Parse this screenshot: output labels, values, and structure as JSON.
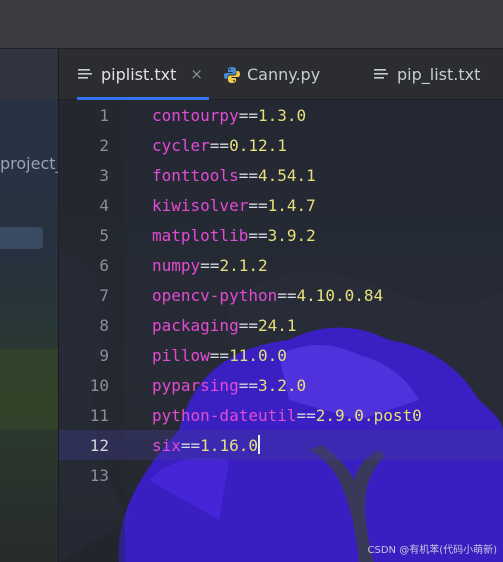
{
  "project": {
    "label": "project_"
  },
  "tabs": [
    {
      "label": "piplist.txt",
      "icon": "text-file-icon",
      "active": true,
      "close": "×"
    },
    {
      "label": "Canny.py",
      "icon": "python-icon",
      "active": false
    },
    {
      "label": "pip_list.txt",
      "icon": "text-file-icon",
      "active": false
    }
  ],
  "editor": {
    "lines": [
      {
        "num": "1",
        "pkg": "contourpy",
        "op": "==",
        "ver": "1.3.0"
      },
      {
        "num": "2",
        "pkg": "cycler",
        "op": "==",
        "ver": "0.12.1"
      },
      {
        "num": "3",
        "pkg": "fonttools",
        "op": "==",
        "ver": "4.54.1"
      },
      {
        "num": "4",
        "pkg": "kiwisolver",
        "op": "==",
        "ver": "1.4.7"
      },
      {
        "num": "5",
        "pkg": "matplotlib",
        "op": "==",
        "ver": "3.9.2"
      },
      {
        "num": "6",
        "pkg": "numpy",
        "op": "==",
        "ver": "2.1.2"
      },
      {
        "num": "7",
        "pkg": "opencv-python",
        "op": "==",
        "ver": "4.10.0.84"
      },
      {
        "num": "8",
        "pkg": "packaging",
        "op": "==",
        "ver": "24.1"
      },
      {
        "num": "9",
        "pkg": "pillow",
        "op": "==",
        "ver": "11.0.0"
      },
      {
        "num": "10",
        "pkg": "pyparsing",
        "op": "==",
        "ver": "3.2.0"
      },
      {
        "num": "11",
        "pkg": "python-dateutil",
        "op": "==",
        "ver": "2.9.0.post0"
      },
      {
        "num": "12",
        "pkg": "six",
        "op": "==",
        "ver": "1.16.0"
      },
      {
        "num": "13",
        "pkg": "",
        "op": "",
        "ver": ""
      }
    ],
    "current_line": "12"
  },
  "watermark": "CSDN @有机苯(代码小萌新)",
  "colors": {
    "package": "#e44bd4",
    "version": "#e6e07a",
    "tab_underline": "#3574f0"
  }
}
